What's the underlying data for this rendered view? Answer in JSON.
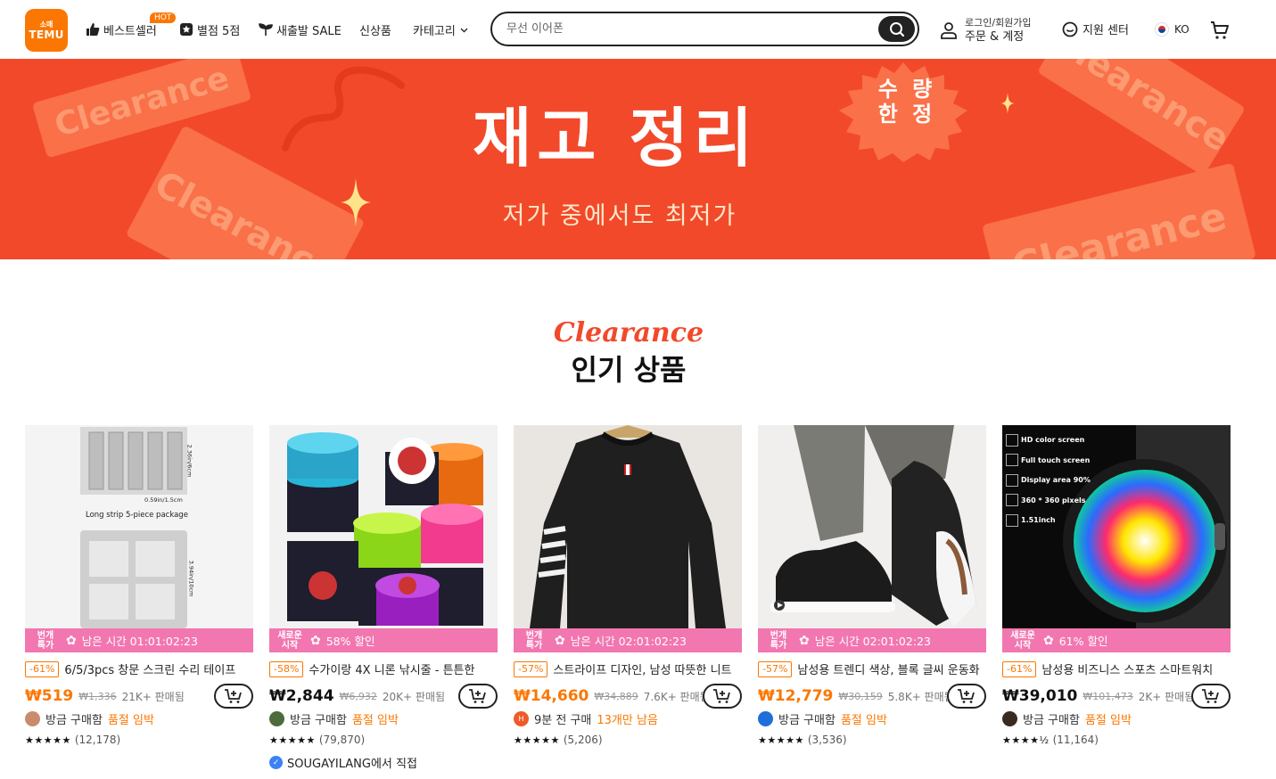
{
  "header": {
    "logo_line1": "소매",
    "logo_line2": "TEMU",
    "nav": [
      {
        "label": "베스트셀러",
        "icon": "thumbs-up-icon"
      },
      {
        "label": "별점 5점",
        "icon": "star-badge-icon"
      },
      {
        "label": "새출발 SALE",
        "icon": "sprout-icon"
      },
      {
        "label": "신상품",
        "icon": ""
      },
      {
        "label": "카테고리",
        "icon": "chevron-down-icon"
      }
    ],
    "hot_badge": "HOT",
    "search_placeholder": "무선 이어폰",
    "account_line1": "로그인/회원가입",
    "account_line2": "주문 & 계정",
    "support": "지원 센터",
    "lang": "KO"
  },
  "banner": {
    "title": "재고 정리",
    "subtitle": "저가 중에서도 최저가",
    "badge_line1": "수 량",
    "badge_line2": "한 정",
    "tag_text": "Clearance"
  },
  "section": {
    "script": "Clearance",
    "title": "인기 상품"
  },
  "products": [
    {
      "strip_label": "번개 특가",
      "strip_text": "남은 시간 01:01:02:23",
      "discount": "-61%",
      "title": "6/5/3pcs 창문 스크린 수리 테이프",
      "price": "₩519",
      "orig_price": "₩1,336",
      "sold": "21K+ 판매됨",
      "buy_text": "방금 구매함",
      "urgency": "품절 임박",
      "stars": "★★★★★",
      "reviews": "(12,178)",
      "img_label1": "Long strip 5-piece package",
      "img_label2": "0.59in/1.5cm",
      "img_label3": "2.36in/6cm",
      "img_label4": "3.94in/10cm"
    },
    {
      "strip_label": "새로운 시작",
      "strip_text": "58% 할인",
      "discount": "-58%",
      "title": "수가이랑 4X 니론 낚시줄 - 튼튼한",
      "price": "₩2,844",
      "orig_price": "₩6,932",
      "sold": "20K+ 판매됨",
      "buy_text": "방금 구매함",
      "urgency": "품절 임박",
      "stars": "★★★★★",
      "reviews": "(79,870)",
      "store": "SOUGAYILANG에서 직접"
    },
    {
      "strip_label": "번개 특가",
      "strip_text": "남은 시간 02:01:02:23",
      "discount": "-57%",
      "title": "스트라이프 디자인, 남성 따뜻한 니트",
      "price": "₩14,660",
      "orig_price": "₩34,889",
      "sold": "7.6K+ 판매됨",
      "buy_text": "9분 전 구매",
      "urgency": "13개만 남음",
      "avatar_letter": "H",
      "stars": "★★★★★",
      "reviews": "(5,206)"
    },
    {
      "strip_label": "번개 특가",
      "strip_text": "남은 시간 02:01:02:23",
      "discount": "-57%",
      "title": "남성용 트렌디 색상, 블록 글씨 운동화",
      "price": "₩12,779",
      "orig_price": "₩30,159",
      "sold": "5.8K+ 판매됨",
      "buy_text": "방금 구매함",
      "urgency": "품절 임박",
      "stars": "★★★★★",
      "reviews": "(3,536)"
    },
    {
      "strip_label": "새로운 시작",
      "strip_text": "61% 할인",
      "discount": "-61%",
      "title": "남성용 비즈니스 스포츠 스마트워치",
      "price": "₩39,010",
      "orig_price": "₩101,473",
      "sold": "2K+ 판매됨",
      "buy_text": "방금 구매함",
      "urgency": "품절 임박",
      "stars": "★★★★½",
      "reviews": "(11,164)",
      "features": [
        "HD color screen",
        "Full touch screen",
        "Display area 90%",
        "360 * 360 pixels",
        "1.51inch"
      ]
    }
  ],
  "colors": {
    "brand": "#fb7701",
    "banner": "#f2492b",
    "strip": "#f277b0"
  }
}
